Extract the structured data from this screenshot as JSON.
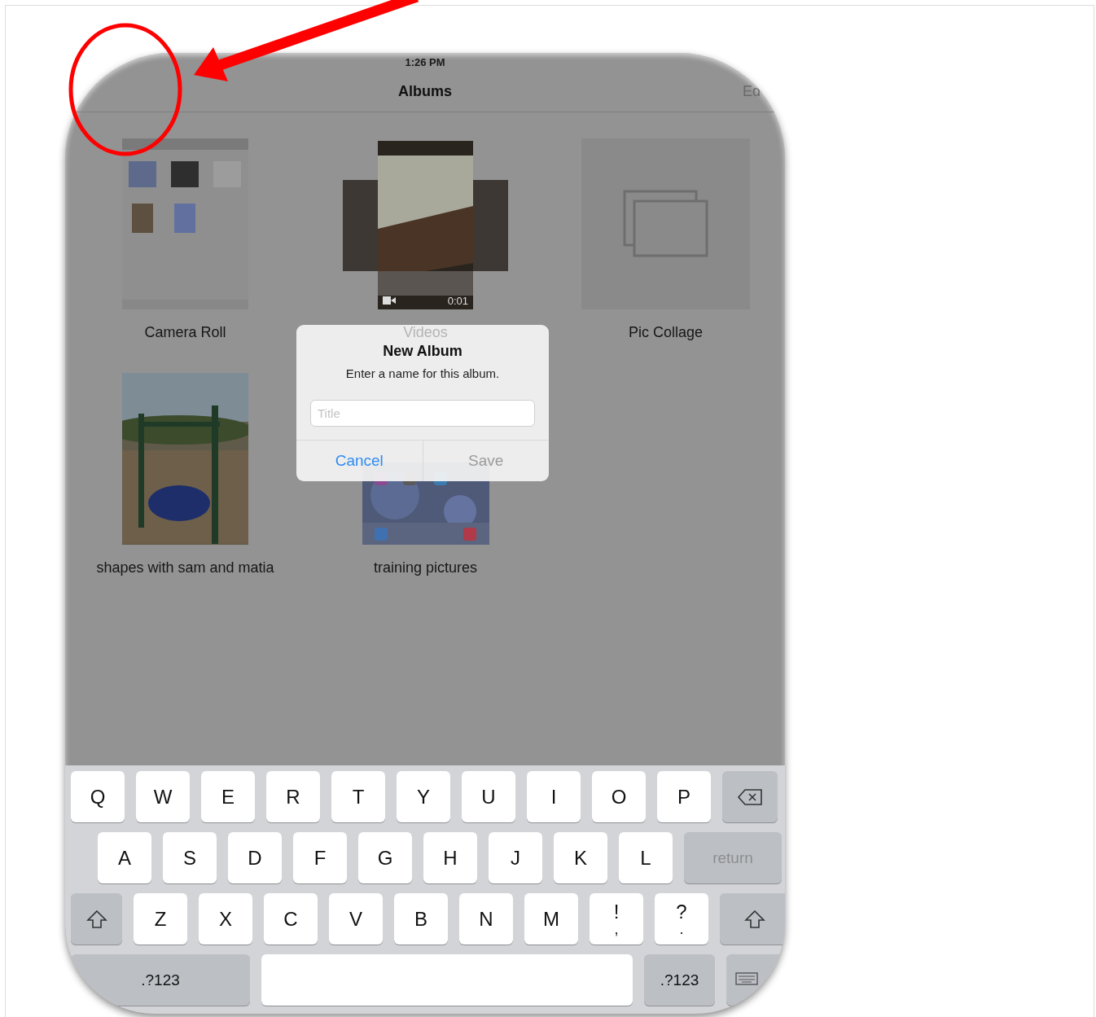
{
  "status_bar": {
    "time": "1:26 PM"
  },
  "nav": {
    "title": "Albums",
    "right_button": "Ed"
  },
  "albums": [
    {
      "name": "Camera Roll",
      "kind": "screenshot"
    },
    {
      "name": "Videos",
      "kind": "video",
      "duration": "0:01"
    },
    {
      "name": "Pic Collage",
      "kind": "empty"
    },
    {
      "name": "shapes with sam and matia",
      "kind": "playground"
    },
    {
      "name": "training pictures",
      "kind": "homescreen"
    }
  ],
  "dialog": {
    "title": "New Album",
    "message": "Enter a name for this album.",
    "field": {
      "placeholder": "Title"
    },
    "buttons": [
      {
        "label": "Cancel",
        "disabled": false
      },
      {
        "label": "Save",
        "disabled": true
      }
    ]
  },
  "keyboard": {
    "rows": [
      {
        "keys": [
          {
            "kind": "letter",
            "label": "Q"
          },
          {
            "kind": "letter",
            "label": "W"
          },
          {
            "kind": "letter",
            "label": "E"
          },
          {
            "kind": "letter",
            "label": "R"
          },
          {
            "kind": "letter",
            "label": "T"
          },
          {
            "kind": "letter",
            "label": "Y"
          },
          {
            "kind": "letter",
            "label": "U"
          },
          {
            "kind": "letter",
            "label": "I"
          },
          {
            "kind": "letter",
            "label": "O"
          },
          {
            "kind": "letter",
            "label": "P"
          },
          {
            "kind": "delete"
          }
        ]
      },
      {
        "keys": [
          {
            "kind": "letter",
            "label": "A"
          },
          {
            "kind": "letter",
            "label": "S"
          },
          {
            "kind": "letter",
            "label": "D"
          },
          {
            "kind": "letter",
            "label": "F"
          },
          {
            "kind": "letter",
            "label": "G"
          },
          {
            "kind": "letter",
            "label": "H"
          },
          {
            "kind": "letter",
            "label": "J"
          },
          {
            "kind": "letter",
            "label": "K"
          },
          {
            "kind": "letter",
            "label": "L"
          },
          {
            "kind": "return",
            "label": "return"
          }
        ]
      },
      {
        "keys": [
          {
            "kind": "shift"
          },
          {
            "kind": "letter",
            "label": "Z"
          },
          {
            "kind": "letter",
            "label": "X"
          },
          {
            "kind": "letter",
            "label": "C"
          },
          {
            "kind": "letter",
            "label": "V"
          },
          {
            "kind": "letter",
            "label": "B"
          },
          {
            "kind": "letter",
            "label": "N"
          },
          {
            "kind": "letter",
            "label": "M"
          },
          {
            "kind": "punct",
            "top": "!",
            "bottom": ","
          },
          {
            "kind": "punct",
            "top": "?",
            "bottom": "."
          },
          {
            "kind": "shift"
          }
        ]
      },
      {
        "keys": [
          {
            "kind": "mode",
            "label": ".?123"
          },
          {
            "kind": "space"
          },
          {
            "kind": "mode",
            "label": ".?123"
          },
          {
            "kind": "dismiss"
          }
        ]
      }
    ]
  }
}
